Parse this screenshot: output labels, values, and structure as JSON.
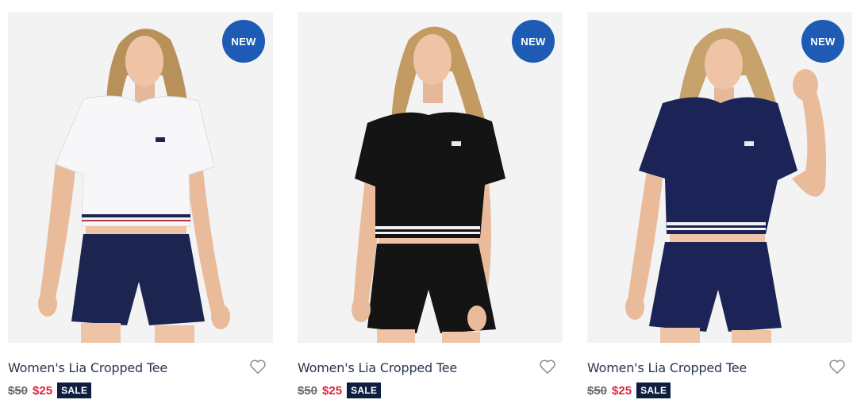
{
  "products": [
    {
      "badge": "NEW",
      "title": "Women's Lia Cropped Tee",
      "old_price": "$50",
      "new_price": "$25",
      "sale_label": "SALE",
      "shirt_color": "#f7f7fa",
      "shorts_color": "#1c2550",
      "icon": "heart-outline-icon"
    },
    {
      "badge": "NEW",
      "title": "Women's Lia Cropped Tee",
      "old_price": "$50",
      "new_price": "$25",
      "sale_label": "SALE",
      "shirt_color": "#141414",
      "shorts_color": "#141414",
      "icon": "heart-outline-icon"
    },
    {
      "badge": "NEW",
      "title": "Women's Lia Cropped Tee",
      "old_price": "$50",
      "new_price": "$25",
      "sale_label": "SALE",
      "shirt_color": "#1c2457",
      "shorts_color": "#1c2457",
      "icon": "heart-outline-icon"
    }
  ],
  "colors": {
    "badge_bg": "#1d5bb5",
    "sale_red": "#e0253b",
    "sale_tag_bg": "#0f1d3f"
  }
}
